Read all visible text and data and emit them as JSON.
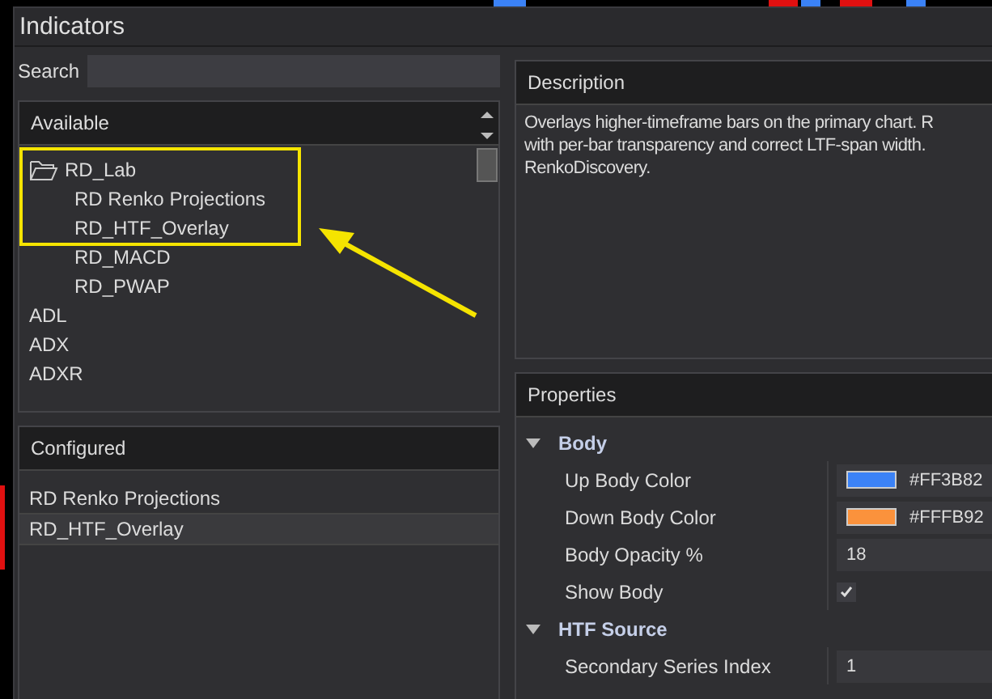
{
  "window": {
    "title": "Indicators"
  },
  "search": {
    "label": "Search"
  },
  "available": {
    "title": "Available",
    "items": [
      {
        "label": "RD_Lab",
        "kind": "folder",
        "expanded": true,
        "children": [
          {
            "label": "RD Renko Projections"
          },
          {
            "label": "RD_HTF_Overlay"
          },
          {
            "label": "RD_MACD"
          },
          {
            "label": "RD_PWAP"
          }
        ]
      },
      {
        "label": "ADL",
        "kind": "item"
      },
      {
        "label": "ADX",
        "kind": "item"
      },
      {
        "label": "ADXR",
        "kind": "item"
      }
    ]
  },
  "configured": {
    "title": "Configured",
    "items": [
      {
        "label": "RD Renko Projections",
        "selected": false
      },
      {
        "label": "RD_HTF_Overlay",
        "selected": true
      }
    ]
  },
  "description": {
    "title": "Description",
    "text": "Overlays higher-timeframe bars on the primary chart. R\nwith per-bar transparency and correct LTF-span width.\nRenkoDiscovery."
  },
  "properties": {
    "title": "Properties",
    "groups": [
      {
        "label": "Body",
        "expanded": true,
        "rows": [
          {
            "label": "Up Body Color",
            "kind": "color",
            "color": "#3b82f6",
            "value": "#FF3B82"
          },
          {
            "label": "Down Body Color",
            "kind": "color",
            "color": "#fb923c",
            "value": "#FFFB92"
          },
          {
            "label": "Body Opacity %",
            "kind": "number",
            "value": "18"
          },
          {
            "label": "Show Body",
            "kind": "checkbox",
            "checked": true
          }
        ]
      },
      {
        "label": "HTF Source",
        "expanded": true,
        "rows": [
          {
            "label": "Secondary Series Index",
            "kind": "number",
            "value": "1"
          }
        ]
      }
    ]
  }
}
